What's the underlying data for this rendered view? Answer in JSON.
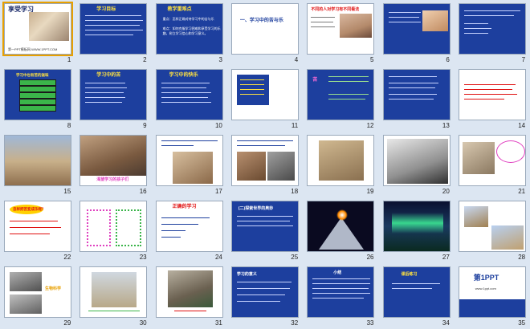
{
  "slides": [
    {
      "num": "1",
      "title": "享受学习",
      "caption": "第一PPT模板网-WWW.1PPT.COM"
    },
    {
      "num": "2",
      "title": "学习目标"
    },
    {
      "num": "3",
      "title": "教学重难点",
      "lines": [
        "重点：怎样正确对待学习中的苦与乐",
        "难点：如何克服学习困难和享受学习的乐趣，树立学习信心和学习意义。"
      ]
    },
    {
      "num": "4",
      "title": "一、学习中的苦与乐"
    },
    {
      "num": "5",
      "title": "不同的人对学习有不同看法"
    },
    {
      "num": "6"
    },
    {
      "num": "7"
    },
    {
      "num": "8",
      "title": "学习中也有苦的滋味"
    },
    {
      "num": "9",
      "title": "学习中的苦"
    },
    {
      "num": "10",
      "title": "学习中的快乐"
    },
    {
      "num": "11"
    },
    {
      "num": "12",
      "tag": "苦"
    },
    {
      "num": "13"
    },
    {
      "num": "14"
    },
    {
      "num": "15"
    },
    {
      "num": "16",
      "title": "渴望学习的孩子们"
    },
    {
      "num": "17"
    },
    {
      "num": "18"
    },
    {
      "num": "19"
    },
    {
      "num": "20"
    },
    {
      "num": "21"
    },
    {
      "num": "22",
      "title": "怎样把苦变成乐呢？"
    },
    {
      "num": "23"
    },
    {
      "num": "24",
      "title": "正确的学习"
    },
    {
      "num": "25",
      "title": "(二)探索世界的奥妙"
    },
    {
      "num": "26"
    },
    {
      "num": "27"
    },
    {
      "num": "28"
    },
    {
      "num": "29",
      "tag": "生物科学"
    },
    {
      "num": "30"
    },
    {
      "num": "31"
    },
    {
      "num": "32",
      "title": "学习的意义"
    },
    {
      "num": "33",
      "title": "小结"
    },
    {
      "num": "34",
      "title": "课后练习"
    },
    {
      "num": "35",
      "logo": "第1PPT",
      "site": "www.1ppt.com"
    }
  ],
  "colors": {
    "slide_blue": "#1d3f9e",
    "accent_yellow": "#ffe240",
    "accent_red": "#e01010",
    "selection": "#e8a000",
    "background": "#dce6f2"
  }
}
